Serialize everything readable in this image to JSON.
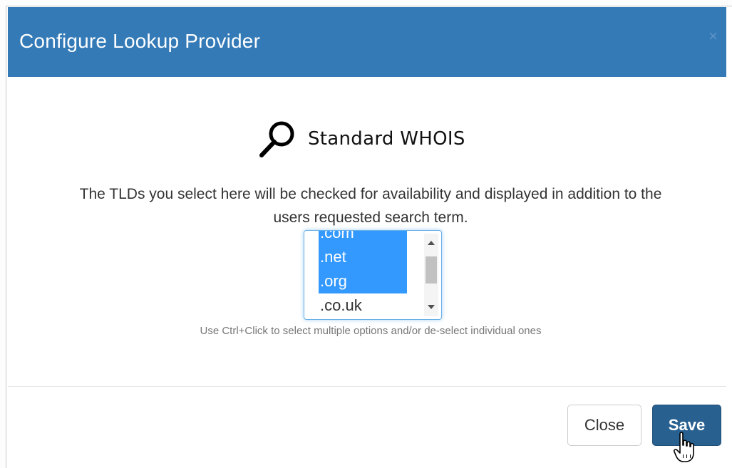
{
  "dialog": {
    "title": "Configure Lookup Provider",
    "close_icon": "×"
  },
  "provider": {
    "icon": "search-icon",
    "name": "Standard WHOIS"
  },
  "description": {
    "line1": "The TLDs you select here will be checked for availability and displayed in addition to the",
    "line2": "users requested search term."
  },
  "tld_select": {
    "options": [
      {
        "label": ".com",
        "selected": true
      },
      {
        "label": ".net",
        "selected": true
      },
      {
        "label": ".org",
        "selected": true
      },
      {
        "label": ".co.uk",
        "selected": false
      }
    ],
    "hint": "Use Ctrl+Click to select multiple options and/or de-select individual ones"
  },
  "footer": {
    "close_label": "Close",
    "save_label": "Save"
  },
  "colors": {
    "header_bg": "#337ab7",
    "primary_button": "#286090",
    "selection": "#3399ff"
  }
}
